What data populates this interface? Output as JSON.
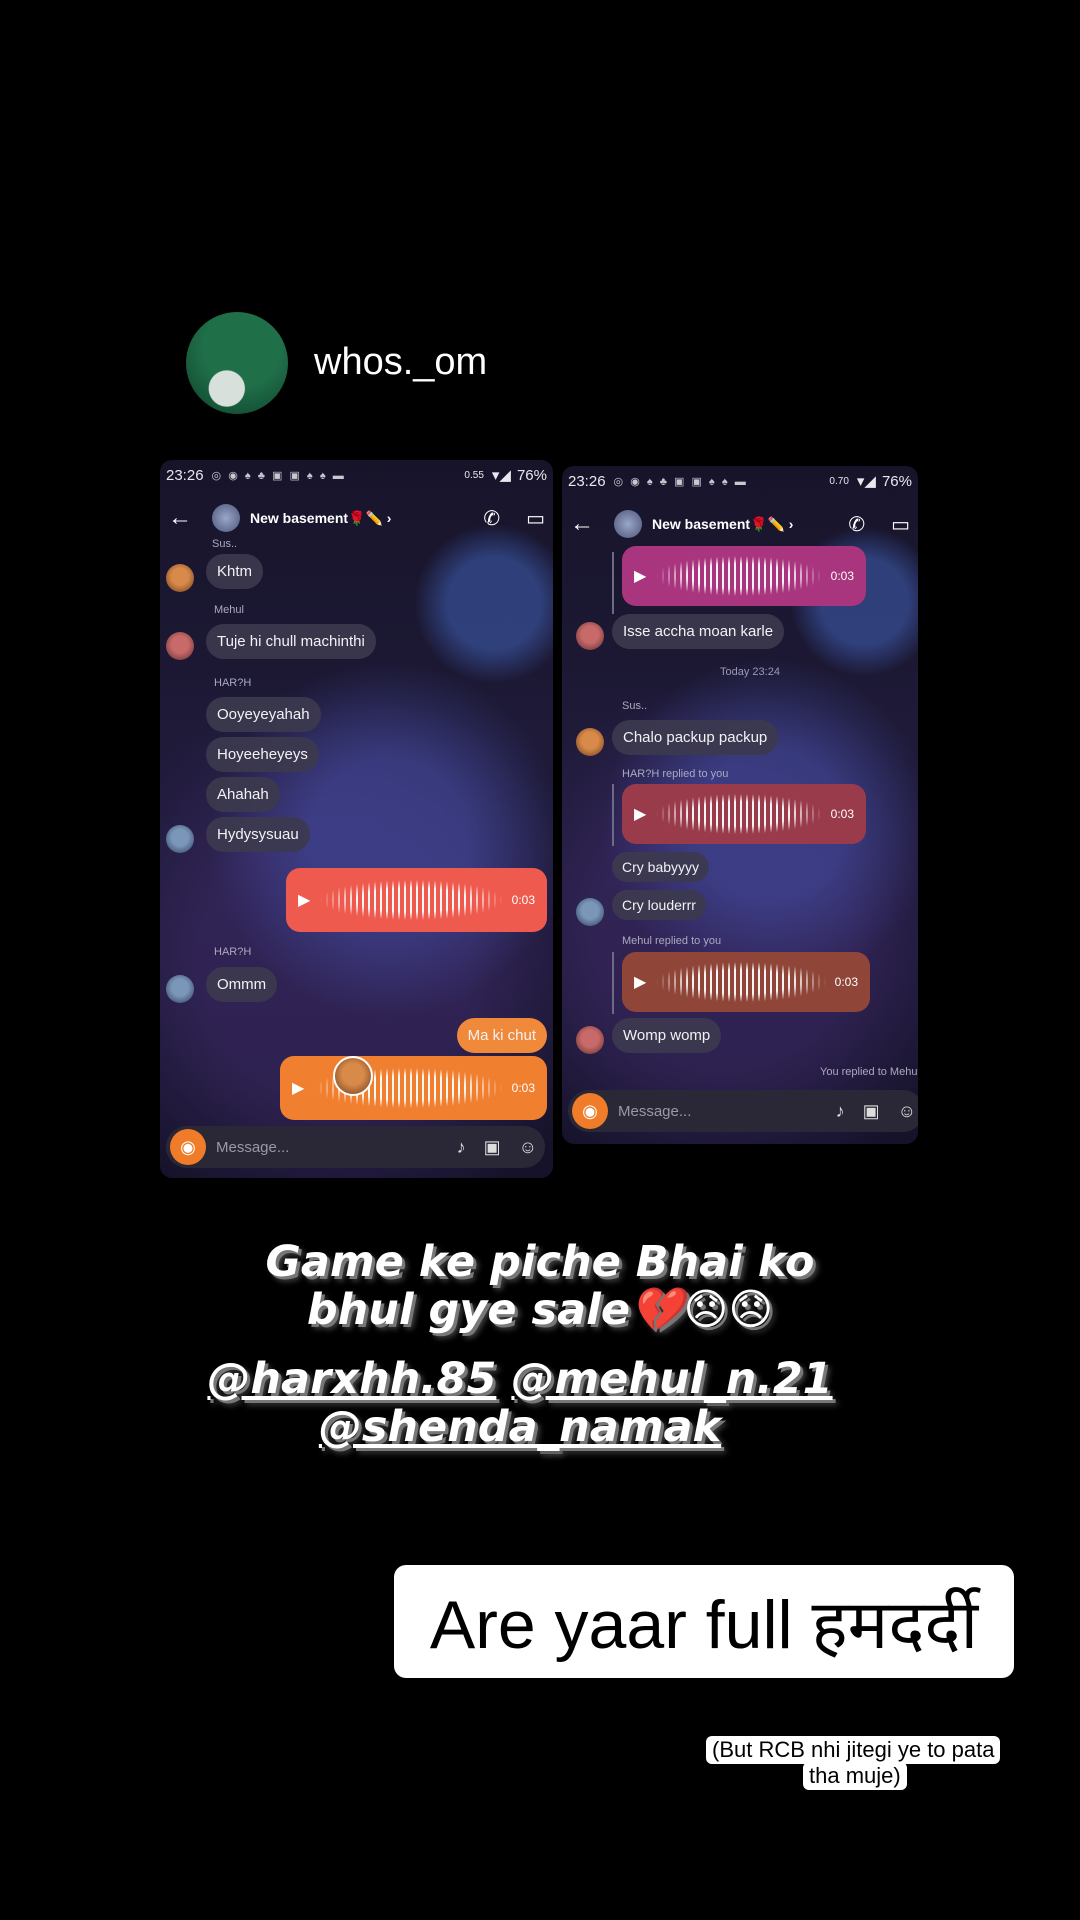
{
  "story": {
    "author_name": "whos._om",
    "caption_line1": "Game ke piche Bhai ko",
    "caption_line2": "bhul gye sale💔😞😞",
    "mentions": [
      "@harxhh.85",
      "@mehul_n.21",
      "@shenda_namak"
    ],
    "sticker_text": "Are yaar full हमदर्दी",
    "note_line1": "(But RCB nhi jitegi ye to pata",
    "note_line2": "tha muje)"
  },
  "left_screenshot": {
    "status": {
      "time": "23:26",
      "speed": "0.55",
      "battery": "76%"
    },
    "group_name": "New basement🌹✏️ ›",
    "messages": [
      {
        "sender": "Sus..",
        "text": "Khtm"
      },
      {
        "sender": "Mehul",
        "text": "Tuje hi chull machinthi"
      },
      {
        "sender": "HAR?H",
        "texts": [
          "Ooyeyeyahah",
          "Hoyeeheyeys",
          "Ahahah",
          "Hydysysuau"
        ]
      },
      {
        "voice_duration": "0:03"
      },
      {
        "sender": "HAR?H",
        "text": "Ommm"
      },
      {
        "outgoing_text": "Ma ki chut"
      },
      {
        "voice_duration": "0:03"
      }
    ],
    "composer_placeholder": "Message..."
  },
  "right_screenshot": {
    "status": {
      "time": "23:26",
      "speed": "0.70",
      "battery": "76%"
    },
    "group_name": "New basement🌹✏️ ›",
    "voice1_duration": "0:03",
    "msg1": "Isse accha moan karle",
    "date_divider": "Today 23:24",
    "sender_sus": "Sus..",
    "msg2": "Chalo packup packup",
    "reply_note1": "HAR?H replied to you",
    "voice2_duration": "0:03",
    "msg3": "Cry babyyyy",
    "msg4": "Cry louderrr",
    "reply_note2": "Mehul replied to you",
    "voice3_duration": "0:03",
    "msg5": "Womp womp",
    "reply_note3": "You replied to Mehu",
    "composer_placeholder": "Message..."
  },
  "colors": {
    "voice_magenta": "#a8357e",
    "voice_red": "#9a3b4c",
    "voice_rust": "#8f4538",
    "voice_coral": "#ef5a4e",
    "voice_orange": "#f08030",
    "camera_orange": "#f07c2a"
  },
  "icons": [
    "back-arrow-icon",
    "phone-icon",
    "video-icon",
    "camera-icon",
    "mic-icon",
    "gallery-icon",
    "sticker-icon",
    "play-icon",
    "wifi-icon",
    "battery-icon"
  ]
}
